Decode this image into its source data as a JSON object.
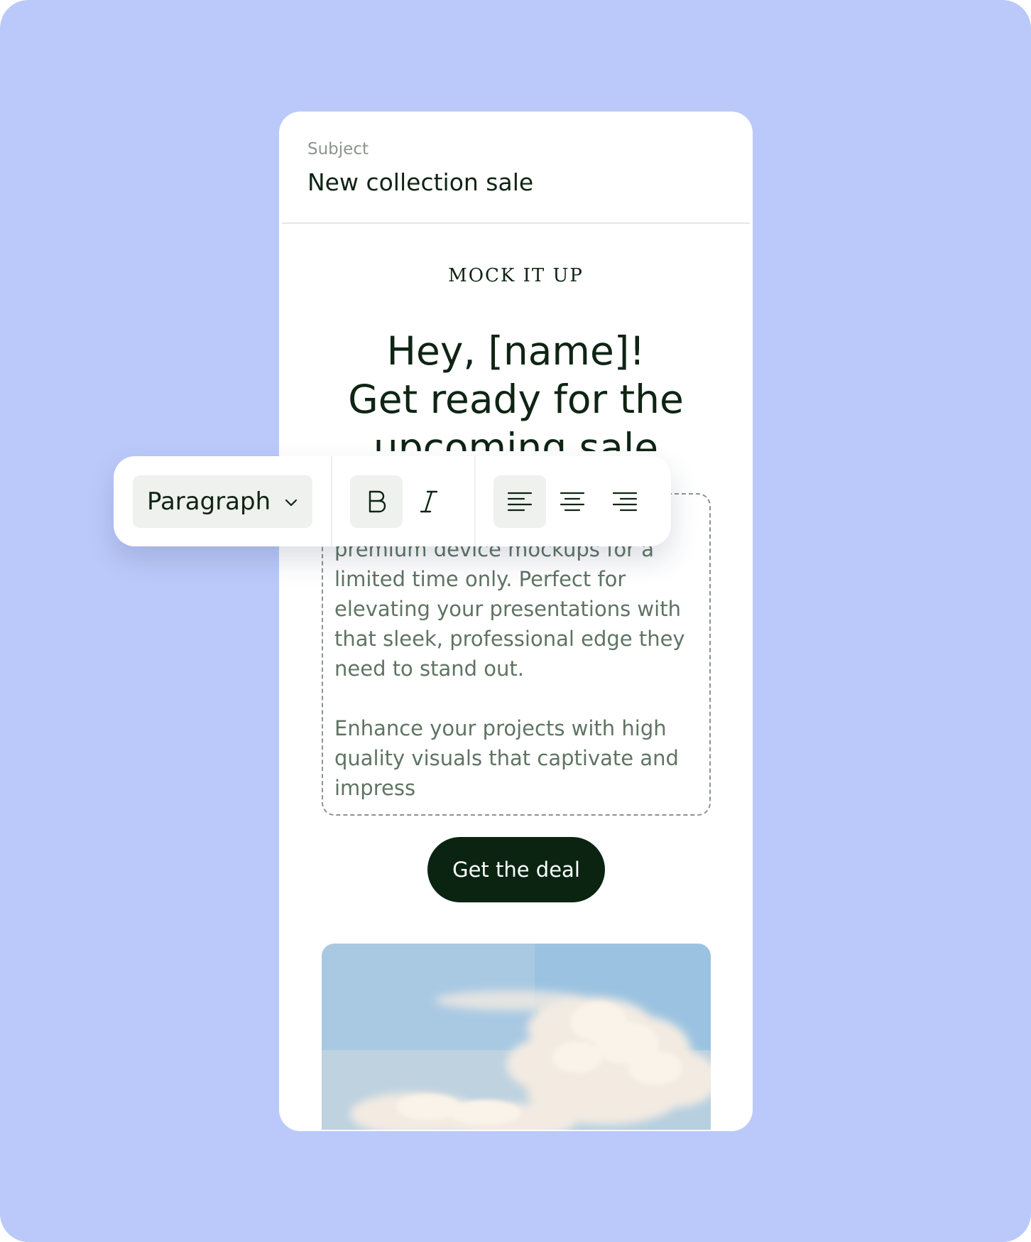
{
  "colors": {
    "backdrop": "#bbc9fa",
    "ink": "#0f2414",
    "muted": "#5f7463",
    "cta_background": "#0a2411"
  },
  "email": {
    "subject_label": "Subject",
    "subject_value": "New collection sale",
    "brand": "MOCK IT UP",
    "headline_line1": "Hey, [name]!",
    "headline_line2": "Get ready for the",
    "headline_line3": "upcoming sale",
    "body_paragraph_1_line1": "premium device mockups for a",
    "body_paragraph_1_line2": "limited time only. Perfect for",
    "body_paragraph_1_line3": "elevating your presentations with",
    "body_paragraph_1_line4": "that sleek, professional edge they",
    "body_paragraph_1_line5": "need to stand out.",
    "body_paragraph_2_line1": "Enhance your projects with high",
    "body_paragraph_2_line2": "quality visuals that captivate and",
    "body_paragraph_2_line3": "impress",
    "cta_label": "Get the deal"
  },
  "toolbar": {
    "block_style": "Paragraph",
    "icons": [
      "chevron-down-icon",
      "bold-icon",
      "italic-icon",
      "align-left-icon",
      "align-center-icon",
      "align-right-icon"
    ],
    "active": [
      "bold",
      "align-left"
    ]
  }
}
